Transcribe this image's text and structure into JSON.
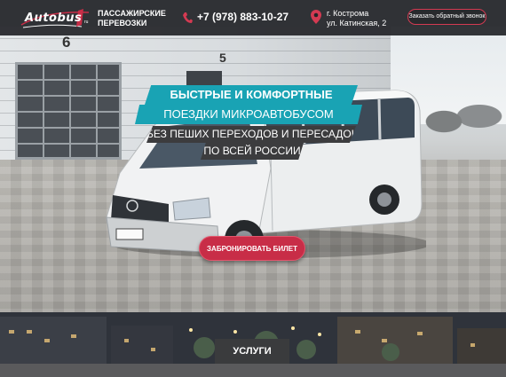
{
  "header": {
    "logo_text": "Autobus",
    "logo_suffix": "ru",
    "tagline_line1": "ПАССАЖИРСКИЕ",
    "tagline_line2": "ПЕРЕВОЗКИ",
    "phone": "+7 (978) 883-10-27",
    "city": "г. Кострома",
    "street": "ул. Катинская, 2",
    "callback_label": "Заказать обратный звонок"
  },
  "hero": {
    "building_number_1": "6",
    "building_number_2": "5",
    "line1": "БЫСТРЫЕ И КОМФОРТНЫЕ",
    "line2": "ПОЕЗДКИ МИКРОАВТОБУСОМ",
    "line3": "БЕЗ ПЕШИХ ПЕРЕХОДОВ И ПЕРЕСАДОК",
    "line4": "ПО ВСЕЙ РОССИИ",
    "book_label": "ЗАБРОНИРОВАТЬ БИЛЕТ"
  },
  "services": {
    "label": "УСЛУГИ"
  },
  "colors": {
    "accent_red": "#c82d47",
    "accent_teal": "#19a3b4",
    "header_bg": "#232428",
    "banner_dark": "#3c3c3e"
  },
  "icons": {
    "phone": "phone-icon",
    "location": "location-pin-icon"
  }
}
